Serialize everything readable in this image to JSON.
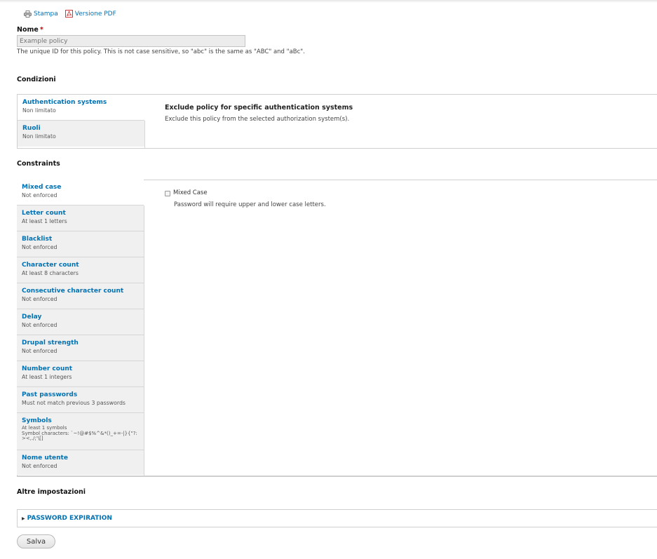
{
  "toplinks": {
    "print_label": "Stampa",
    "pdf_label": "Versione PDF"
  },
  "nome": {
    "label": "Nome",
    "required_mark": "*",
    "placeholder": "Example policy",
    "description": "The unique ID for this policy. This is not case sensitive, so \"abc\" is the same as \"ABC\" and \"aBc\"."
  },
  "conditions": {
    "title": "Condizioni",
    "tabs": [
      {
        "label": "Authentication systems",
        "summary": "Non limitato"
      },
      {
        "label": "Ruoli",
        "summary": "Non limitato"
      }
    ],
    "pane": {
      "title": "Exclude policy for specific authentication systems",
      "description": "Exclude this policy from the selected authorization system(s)."
    }
  },
  "constraints": {
    "title": "Constraints",
    "tabs": [
      {
        "label": "Mixed case",
        "summary": "Not enforced"
      },
      {
        "label": "Letter count",
        "summary": "At least 1 letters"
      },
      {
        "label": "Blacklist",
        "summary": "Not enforced"
      },
      {
        "label": "Character count",
        "summary": "At least 8 characters"
      },
      {
        "label": "Consecutive character count",
        "summary": "Not enforced"
      },
      {
        "label": "Delay",
        "summary": "Not enforced"
      },
      {
        "label": "Drupal strength",
        "summary": "Not enforced"
      },
      {
        "label": "Number count",
        "summary": "At least 1 integers"
      },
      {
        "label": "Past passwords",
        "summary": "Must not match previous 3 passwords"
      },
      {
        "label": "Symbols",
        "summary": "At least 1 symbols\nSymbol characters: `~!@#$%^&*()_+=-|}{\"?:><,./;'\\[]"
      },
      {
        "label": "Nome utente",
        "summary": "Not enforced"
      }
    ],
    "pane": {
      "checkbox_label": "Mixed Case",
      "checkbox_description": "Password will require upper and lower case letters."
    }
  },
  "other": {
    "title": "Altre impostazioni",
    "details_label": "PASSWORD EXPIRATION"
  },
  "save_label": "Salva"
}
